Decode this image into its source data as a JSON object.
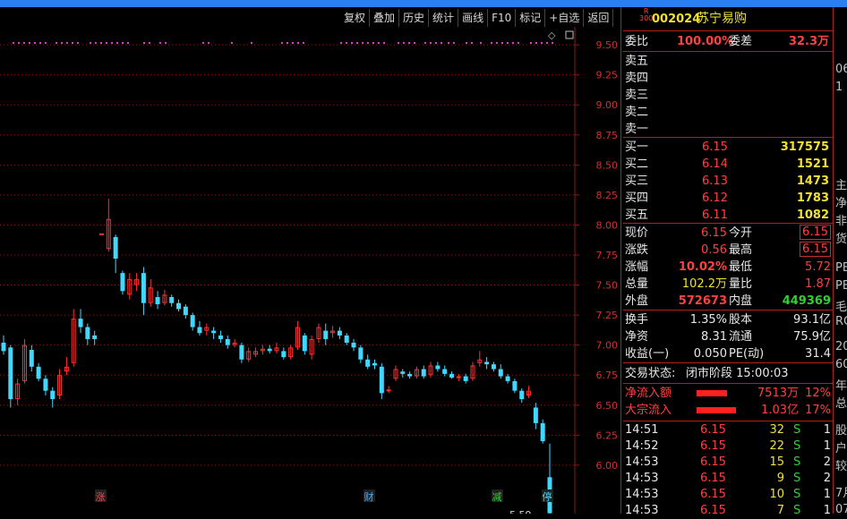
{
  "toolbar": {
    "buttons": [
      "复权",
      "叠加",
      "历史",
      "统计",
      "画线",
      "F10",
      "标记",
      "+自选",
      "返回"
    ]
  },
  "chart_data": {
    "type": "candlestick",
    "ylim": [
      5.85,
      9.65
    ],
    "y_ticks": [
      "9.50",
      "9.25",
      "9.00",
      "8.75",
      "8.50",
      "8.25",
      "8.00",
      "7.75",
      "7.50",
      "7.25",
      "7.00",
      "6.75",
      "6.50",
      "6.25",
      "6.00"
    ],
    "low_label": "5.59",
    "colors": {
      "up": "#ff3030",
      "down": "#40d8ff",
      "grid": "#8b1a1a",
      "dots": "#d040d0"
    },
    "markers": [
      {
        "x_index": 0,
        "text": "涨",
        "color": "#ff4040"
      },
      {
        "x_index": 1,
        "text": "财",
        "color": "#40b0ff"
      },
      {
        "x_index": 2,
        "text": "减",
        "color": "#30d030"
      },
      {
        "x_index": 3,
        "text": "停",
        "color": "#40d8ff"
      }
    ],
    "candles": [
      {
        "o": 7.02,
        "c": 6.95,
        "h": 7.08,
        "l": 6.92
      },
      {
        "o": 6.98,
        "c": 6.55,
        "h": 7.0,
        "l": 6.48
      },
      {
        "o": 6.55,
        "c": 6.68,
        "h": 6.72,
        "l": 6.5
      },
      {
        "o": 6.7,
        "c": 7.0,
        "h": 7.05,
        "l": 6.68
      },
      {
        "o": 6.96,
        "c": 6.82,
        "h": 7.0,
        "l": 6.78
      },
      {
        "o": 6.82,
        "c": 6.72,
        "h": 6.85,
        "l": 6.7
      },
      {
        "o": 6.72,
        "c": 6.62,
        "h": 6.75,
        "l": 6.58
      },
      {
        "o": 6.62,
        "c": 6.55,
        "h": 6.65,
        "l": 6.48
      },
      {
        "o": 6.58,
        "c": 6.75,
        "h": 6.8,
        "l": 6.55
      },
      {
        "o": 6.78,
        "c": 6.82,
        "h": 6.9,
        "l": 6.75
      },
      {
        "o": 6.85,
        "c": 7.22,
        "h": 7.3,
        "l": 6.82
      },
      {
        "o": 7.22,
        "c": 7.15,
        "h": 7.3,
        "l": 7.1
      },
      {
        "o": 7.15,
        "c": 7.05,
        "h": 7.18,
        "l": 7.0
      },
      {
        "o": 7.08,
        "c": 7.05,
        "h": 7.12,
        "l": 7.0
      },
      {
        "o": 7.93,
        "c": 7.93,
        "h": 7.93,
        "l": 7.93
      },
      {
        "o": 7.8,
        "c": 8.05,
        "h": 8.22,
        "l": 7.78
      },
      {
        "o": 7.9,
        "c": 7.72,
        "h": 7.92,
        "l": 7.6
      },
      {
        "o": 7.6,
        "c": 7.45,
        "h": 7.62,
        "l": 7.42
      },
      {
        "o": 7.42,
        "c": 7.55,
        "h": 7.6,
        "l": 7.38
      },
      {
        "o": 7.5,
        "c": 7.55,
        "h": 7.6,
        "l": 7.45
      },
      {
        "o": 7.6,
        "c": 7.35,
        "h": 7.65,
        "l": 7.25
      },
      {
        "o": 7.35,
        "c": 7.48,
        "h": 7.55,
        "l": 7.32
      },
      {
        "o": 7.4,
        "c": 7.34,
        "h": 7.45,
        "l": 7.3
      },
      {
        "o": 7.35,
        "c": 7.42,
        "h": 7.46,
        "l": 7.33
      },
      {
        "o": 7.4,
        "c": 7.35,
        "h": 7.42,
        "l": 7.32
      },
      {
        "o": 7.35,
        "c": 7.3,
        "h": 7.38,
        "l": 7.28
      },
      {
        "o": 7.32,
        "c": 7.25,
        "h": 7.34,
        "l": 7.22
      },
      {
        "o": 7.25,
        "c": 7.15,
        "h": 7.27,
        "l": 7.12
      },
      {
        "o": 7.15,
        "c": 7.1,
        "h": 7.2,
        "l": 7.08
      },
      {
        "o": 7.12,
        "c": 7.15,
        "h": 7.18,
        "l": 7.08
      },
      {
        "o": 7.12,
        "c": 7.1,
        "h": 7.15,
        "l": 7.05
      },
      {
        "o": 7.08,
        "c": 7.05,
        "h": 7.12,
        "l": 7.02
      },
      {
        "o": 7.05,
        "c": 7.0,
        "h": 7.08,
        "l": 6.97
      },
      {
        "o": 7.0,
        "c": 7.02,
        "h": 7.05,
        "l": 6.98
      },
      {
        "o": 7.0,
        "c": 6.88,
        "h": 7.02,
        "l": 6.85
      },
      {
        "o": 6.88,
        "c": 6.95,
        "h": 6.98,
        "l": 6.86
      },
      {
        "o": 6.92,
        "c": 6.95,
        "h": 6.98,
        "l": 6.9
      },
      {
        "o": 6.95,
        "c": 6.97,
        "h": 7.0,
        "l": 6.92
      },
      {
        "o": 6.97,
        "c": 6.95,
        "h": 7.0,
        "l": 6.93
      },
      {
        "o": 6.95,
        "c": 6.98,
        "h": 7.02,
        "l": 6.93
      },
      {
        "o": 6.95,
        "c": 6.9,
        "h": 6.98,
        "l": 6.88
      },
      {
        "o": 6.9,
        "c": 6.98,
        "h": 7.0,
        "l": 6.88
      },
      {
        "o": 6.98,
        "c": 7.15,
        "h": 7.2,
        "l": 6.96
      },
      {
        "o": 7.08,
        "c": 6.95,
        "h": 7.1,
        "l": 6.92
      },
      {
        "o": 6.92,
        "c": 7.05,
        "h": 7.08,
        "l": 6.88
      },
      {
        "o": 7.05,
        "c": 7.15,
        "h": 7.18,
        "l": 7.02
      },
      {
        "o": 7.12,
        "c": 7.05,
        "h": 7.18,
        "l": 7.0
      },
      {
        "o": 7.1,
        "c": 7.12,
        "h": 7.16,
        "l": 7.06
      },
      {
        "o": 7.12,
        "c": 7.08,
        "h": 7.15,
        "l": 7.05
      },
      {
        "o": 7.08,
        "c": 7.02,
        "h": 7.1,
        "l": 7.0
      },
      {
        "o": 7.02,
        "c": 6.98,
        "h": 7.05,
        "l": 6.95
      },
      {
        "o": 6.98,
        "c": 6.88,
        "h": 7.0,
        "l": 6.85
      },
      {
        "o": 6.88,
        "c": 6.82,
        "h": 6.92,
        "l": 6.8
      },
      {
        "o": 6.85,
        "c": 6.83,
        "h": 6.88,
        "l": 6.8
      },
      {
        "o": 6.82,
        "c": 6.6,
        "h": 6.85,
        "l": 6.55
      },
      {
        "o": 6.62,
        "c": 6.63,
        "h": 6.66,
        "l": 6.6
      },
      {
        "o": 6.72,
        "c": 6.8,
        "h": 6.83,
        "l": 6.7
      },
      {
        "o": 6.78,
        "c": 6.76,
        "h": 6.8,
        "l": 6.73
      },
      {
        "o": 6.76,
        "c": 6.74,
        "h": 6.78,
        "l": 6.72
      },
      {
        "o": 6.74,
        "c": 6.8,
        "h": 6.82,
        "l": 6.72
      },
      {
        "o": 6.8,
        "c": 6.74,
        "h": 6.83,
        "l": 6.72
      },
      {
        "o": 6.75,
        "c": 6.83,
        "h": 6.86,
        "l": 6.73
      },
      {
        "o": 6.83,
        "c": 6.8,
        "h": 6.86,
        "l": 6.78
      },
      {
        "o": 6.8,
        "c": 6.76,
        "h": 6.83,
        "l": 6.74
      },
      {
        "o": 6.76,
        "c": 6.73,
        "h": 6.78,
        "l": 6.72
      },
      {
        "o": 6.73,
        "c": 6.74,
        "h": 6.76,
        "l": 6.7
      },
      {
        "o": 6.74,
        "c": 6.7,
        "h": 6.76,
        "l": 6.68
      },
      {
        "o": 6.72,
        "c": 6.83,
        "h": 6.86,
        "l": 6.7
      },
      {
        "o": 6.85,
        "c": 6.88,
        "h": 6.95,
        "l": 6.82
      },
      {
        "o": 6.86,
        "c": 6.84,
        "h": 6.9,
        "l": 6.8
      },
      {
        "o": 6.84,
        "c": 6.8,
        "h": 6.86,
        "l": 6.78
      },
      {
        "o": 6.8,
        "c": 6.74,
        "h": 6.84,
        "l": 6.72
      },
      {
        "o": 6.74,
        "c": 6.7,
        "h": 6.76,
        "l": 6.68
      },
      {
        "o": 6.7,
        "c": 6.62,
        "h": 6.72,
        "l": 6.6
      },
      {
        "o": 6.62,
        "c": 6.55,
        "h": 6.64,
        "l": 6.52
      },
      {
        "o": 6.58,
        "c": 6.62,
        "h": 6.66,
        "l": 6.56
      },
      {
        "o": 6.48,
        "c": 6.35,
        "h": 6.52,
        "l": 6.3
      },
      {
        "o": 6.35,
        "c": 6.2,
        "h": 6.38,
        "l": 6.18
      },
      {
        "o": 5.9,
        "c": 5.6,
        "h": 6.18,
        "l": 5.59
      }
    ]
  },
  "quote": {
    "logo": "R\n300",
    "code": "002024",
    "name": "苏宁易购",
    "weibi_label": "委比",
    "weibi_value": "100.00%",
    "weicha_label": "委差",
    "weicha_value": "32.3万",
    "sell": [
      {
        "label": "卖五",
        "price": "",
        "vol": ""
      },
      {
        "label": "卖四",
        "price": "",
        "vol": ""
      },
      {
        "label": "卖三",
        "price": "",
        "vol": ""
      },
      {
        "label": "卖二",
        "price": "",
        "vol": ""
      },
      {
        "label": "卖一",
        "price": "",
        "vol": ""
      }
    ],
    "buy": [
      {
        "label": "买一",
        "price": "6.15",
        "vol": "317575"
      },
      {
        "label": "买二",
        "price": "6.14",
        "vol": "1521"
      },
      {
        "label": "买三",
        "price": "6.13",
        "vol": "1473"
      },
      {
        "label": "买四",
        "price": "6.12",
        "vol": "1783"
      },
      {
        "label": "买五",
        "price": "6.11",
        "vol": "1082"
      }
    ],
    "stats1": [
      {
        "l1": "现价",
        "v1": "6.15",
        "l2": "今开",
        "v2": "6.15"
      },
      {
        "l1": "涨跌",
        "v1": "0.56",
        "l2": "最高",
        "v2": "6.15"
      },
      {
        "l1": "涨幅",
        "v1": "10.02%",
        "l2": "最低",
        "v2": "5.72"
      },
      {
        "l1": "总量",
        "v1": "102.2万",
        "l2": "量比",
        "v2": "1.87"
      },
      {
        "l1": "外盘",
        "v1": "572673",
        "l2": "内盘",
        "v2": "449369"
      }
    ],
    "stats2": [
      {
        "l1": "换手",
        "v1": "1.35%",
        "l2": "股本",
        "v2": "93.1亿"
      },
      {
        "l1": "净资",
        "v1": "8.31",
        "l2": "流通",
        "v2": "75.9亿"
      },
      {
        "l1": "收益(一)",
        "v1": "0.050",
        "l2": "PE(动)",
        "v2": "31.4"
      }
    ],
    "status_label": "交易状态:",
    "status_value": "闭市阶段 15:00:03",
    "flows": [
      {
        "label": "净流入额",
        "value": "7513万",
        "pct": "12%"
      },
      {
        "label": "大宗流入",
        "value": "1.03亿",
        "pct": "17%"
      }
    ],
    "ticks": [
      {
        "time": "14:51",
        "price": "6.15",
        "vol": "32",
        "side": "S",
        "n": "1"
      },
      {
        "time": "14:52",
        "price": "6.15",
        "vol": "22",
        "side": "S",
        "n": "1"
      },
      {
        "time": "14:53",
        "price": "6.15",
        "vol": "15",
        "side": "S",
        "n": "2"
      },
      {
        "time": "14:53",
        "price": "6.15",
        "vol": "9",
        "side": "S",
        "n": "2"
      },
      {
        "time": "14:53",
        "price": "6.15",
        "vol": "10",
        "side": "S",
        "n": "1"
      },
      {
        "time": "14:53",
        "price": "6.15",
        "vol": "7",
        "side": "S",
        "n": "1"
      }
    ]
  },
  "far_column": [
    "06",
    "1",
    "主",
    "净",
    "非",
    "货",
    "PE",
    "PE",
    "毛",
    "RO",
    "20",
    "60",
    "年",
    "总",
    "股",
    "户",
    "较",
    "7月",
    "07"
  ]
}
